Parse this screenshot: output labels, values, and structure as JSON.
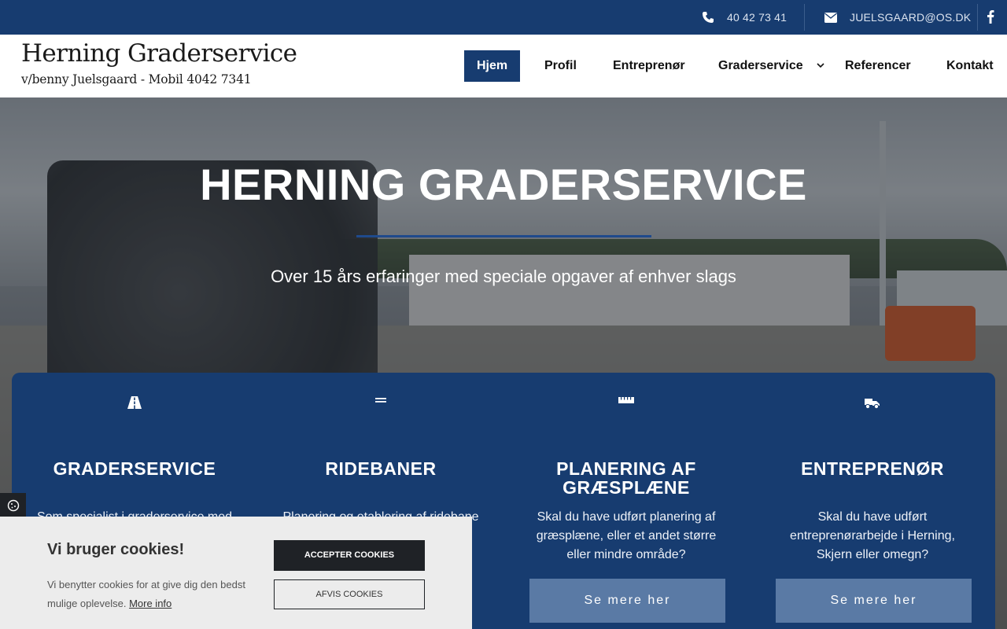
{
  "topbar": {
    "phone": "40 42 73 41",
    "email": "JUELSGAARD@OS.DK",
    "icons": [
      "phone-icon",
      "envelope-icon",
      "facebook-icon"
    ]
  },
  "logo": {
    "line1": "Herning Graderservice",
    "line2": "v/benny Juelsgaard - Mobil 4042 7341"
  },
  "nav": {
    "items": [
      {
        "label": "Hjem",
        "active": true
      },
      {
        "label": "Profil"
      },
      {
        "label": "Entreprenør"
      },
      {
        "label": "Graderservice"
      },
      {
        "label": "Referencer"
      },
      {
        "label": "Kontakt"
      }
    ]
  },
  "hero": {
    "title": "HERNING GRADERSERVICE",
    "subtitle": "Over 15 års erfaringer med speciale opgaver af enhver slags"
  },
  "services": [
    {
      "icon": "road-icon",
      "title": "GRADERSERVICE",
      "text": "Som specialist i graderservice med",
      "button": ""
    },
    {
      "icon": "equals-icon",
      "title": "RIDEBANER",
      "text": "Planering og etablering af ridebane",
      "button": ""
    },
    {
      "icon": "ruler-icon",
      "title": "PLANERING AF GRÆSPLÆNE",
      "text": "Skal du have udført planering af græsplæne, eller et andet større eller mindre område?",
      "button": "Se mere her"
    },
    {
      "icon": "truck-icon",
      "title": "ENTREPRENØR",
      "text": "Skal du have udført entreprenørarbejde i Herning, Skjern eller omegn?",
      "button": "Se mere her"
    }
  ],
  "cookie": {
    "title": "Vi bruger cookies!",
    "text": "Vi benytter cookies for at give dig den bedst mulige oplevelse.",
    "more": "More info",
    "accept": "ACCEPTER COOKIES",
    "decline": "AFVIS COOKIES"
  },
  "colors": {
    "primary": "#173c70",
    "button": "#5a7aa5",
    "dark": "#1f2226",
    "cookie_bg": "#ececec"
  }
}
